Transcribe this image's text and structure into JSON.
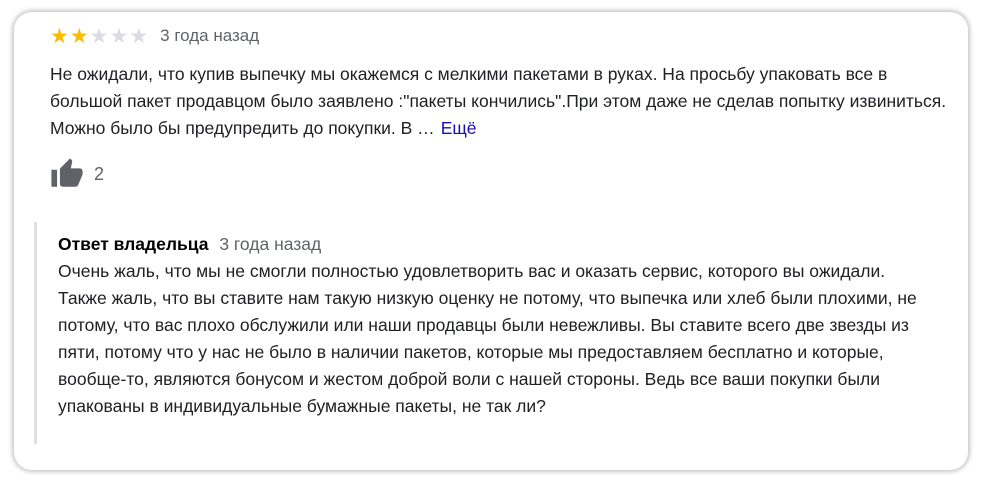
{
  "review": {
    "rating": 2,
    "rating_max": 5,
    "stars": [
      "★",
      "★",
      "★",
      "★",
      "★"
    ],
    "date": "3 года назад",
    "text": "Не ожидали, что купив выпечку мы окажемся с мелкими пакетами в руках. На просьбу упаковать все в большой пакет продавцом было заявлено :\"пакеты кончились\".При этом даже не сделав попытку извиниться. Можно было бы предупредить до покупки. В …",
    "more_label": "Ещё",
    "likes": "2",
    "icons": {
      "like": "thumbs-up-icon"
    }
  },
  "owner_reply": {
    "title": "Ответ владельца",
    "date": "3 года назад",
    "text": "Очень жаль, что мы не смогли полностью удовлетворить вас и оказать сервис, которого вы ожидали. Также жаль, что вы ставите нам такую низкую оценку не потому, что выпечка или хлеб были плохими, не потому, что вас плохо обслужили или наши продавцы были невежливы. Вы ставите всего две звезды из пяти, потому что у нас не было в наличии пакетов, которые мы предоставляем бесплатно и которые, вообще-то, являются бонусом и жестом доброй воли с нашей стороны. Ведь все ваши покупки были упакованы в индивидуальные бумажные пакеты, не так ли?"
  },
  "colors": {
    "star_filled": "#fabb05",
    "star_empty": "#dadce0",
    "link": "#1a0dab",
    "secondary_text": "#5f6368"
  }
}
